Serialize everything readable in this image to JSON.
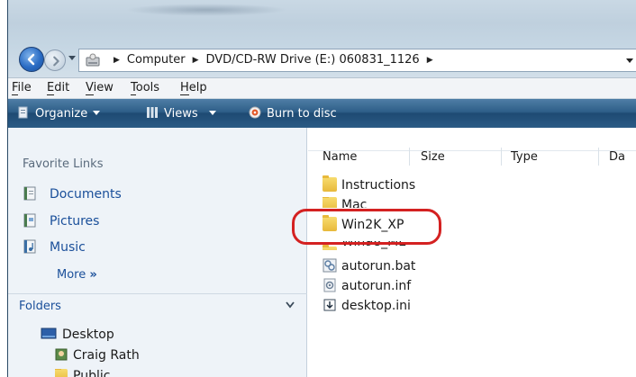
{
  "address": {
    "crumbs": [
      "Computer",
      "DVD/CD-RW Drive (E:) 060831_1126"
    ]
  },
  "menu": {
    "items": [
      {
        "label": "File",
        "key": "F",
        "rest": "ile"
      },
      {
        "label": "Edit",
        "key": "E",
        "rest": "dit"
      },
      {
        "label": "View",
        "key": "V",
        "rest": "iew"
      },
      {
        "label": "Tools",
        "key": "T",
        "rest": "ools"
      },
      {
        "label": "Help",
        "key": "H",
        "rest": "elp"
      }
    ]
  },
  "toolbar": {
    "organize": "Organize",
    "views": "Views",
    "burn": "Burn to disc"
  },
  "nav": {
    "favorites_title": "Favorite Links",
    "favorites": [
      "Documents",
      "Pictures",
      "Music"
    ],
    "more": "More",
    "more_glyph": "»",
    "folders_title": "Folders",
    "tree": [
      "Desktop",
      "Craig Rath",
      "Public"
    ]
  },
  "filelist": {
    "columns": [
      "Name",
      "Size",
      "Type",
      "Da"
    ],
    "items": [
      {
        "name": "Instructions",
        "kind": "folder"
      },
      {
        "name": "Mac",
        "kind": "folder"
      },
      {
        "name": "Win2K_XP",
        "kind": "folder"
      },
      {
        "name": "Win98_ME",
        "kind": "folder"
      },
      {
        "name": "autorun.bat",
        "kind": "bat"
      },
      {
        "name": "autorun.inf",
        "kind": "inf"
      },
      {
        "name": "desktop.ini",
        "kind": "ini"
      }
    ]
  },
  "colors": {
    "toolbar": "#2e5e88",
    "link": "#1a4f9a",
    "highlight_ring": "#d42121",
    "folder": "#e8b93b"
  }
}
